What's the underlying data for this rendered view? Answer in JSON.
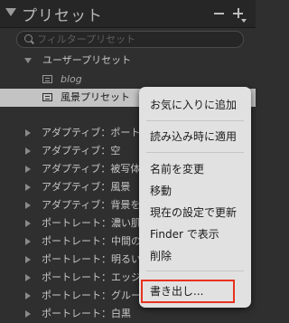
{
  "panel": {
    "title": "プリセット",
    "search_placeholder": "フィルタープリセット"
  },
  "tree": {
    "user_group": "ユーザープリセット",
    "items": [
      {
        "label": "blog"
      },
      {
        "label": "風景プリセット"
      }
    ],
    "groups": [
      "アダプティブ：ポート",
      "アダプティブ：空",
      "アダプティブ：被写体",
      "アダプティブ：風景",
      "アダプティブ：背景を",
      "ポートレート：濃い肌",
      "ポートレート：中間の",
      "ポートレート：明るい",
      "ポートレート：エッジ",
      "ポートレート：グルー",
      "ポートレート：白黒"
    ]
  },
  "context_menu": {
    "add_favorite": "お気に入りに追加",
    "apply_on_import": "読み込み時に適用",
    "rename": "名前を変更",
    "move": "移動",
    "update_current": "現在の設定で更新",
    "show_in_finder": "Finder で表示",
    "delete": "削除",
    "export": "書き出し..."
  }
}
